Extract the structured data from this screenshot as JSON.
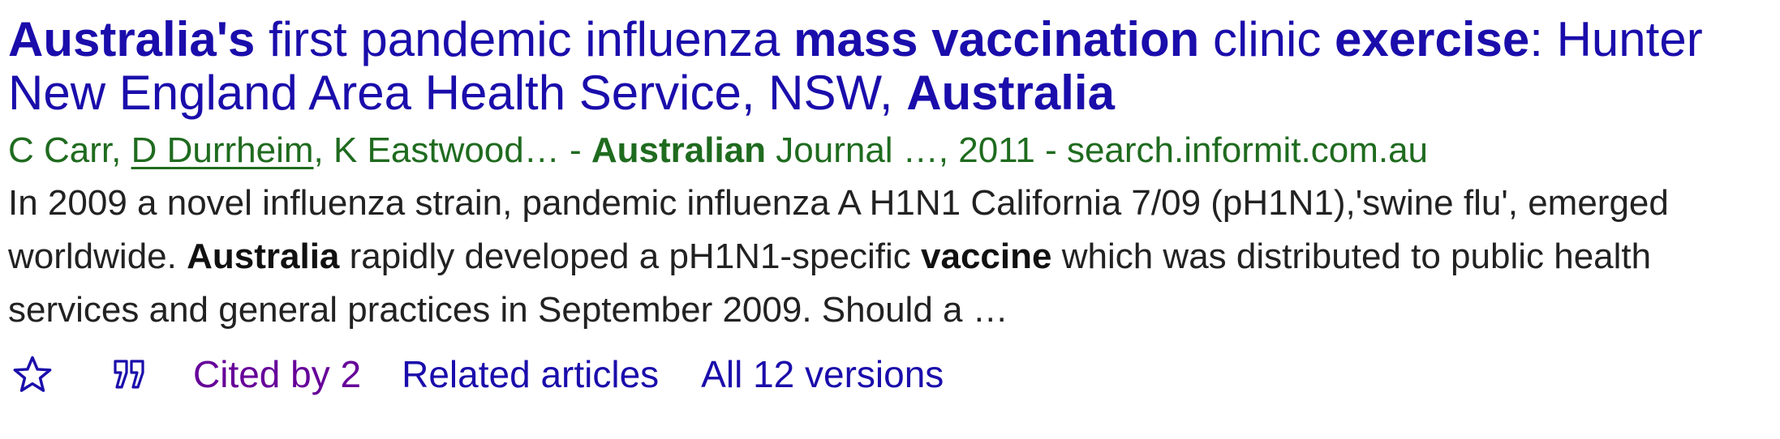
{
  "result": {
    "title": {
      "segments": [
        {
          "text": "Australia's",
          "bold": true
        },
        {
          "text": " first pandemic influenza ",
          "bold": false
        },
        {
          "text": "mass vaccination",
          "bold": true
        },
        {
          "text": " clinic ",
          "bold": false
        },
        {
          "text": "exercise",
          "bold": true
        },
        {
          "text": ": Hunter New England Area Health Service, NSW, ",
          "bold": false
        },
        {
          "text": "Australia",
          "bold": true
        }
      ]
    },
    "meta": {
      "author_1": "C Carr, ",
      "author_2_link": "D Durrheim",
      "author_rest": ", K Eastwood… - ",
      "journal_bold": "Australian",
      "journal_rest": " Journal …, 2011 - search.informit.com.au"
    },
    "snippet": {
      "segments": [
        {
          "text": "In 2009 a novel influenza strain, pandemic influenza A H1N1 California 7/09 (pH1N1),'swine flu', emerged worldwide. ",
          "bold": false
        },
        {
          "text": "Australia",
          "bold": true
        },
        {
          "text": " rapidly developed a pH1N1-specific ",
          "bold": false
        },
        {
          "text": "vaccine",
          "bold": true
        },
        {
          "text": " which was distributed to public health services and general practices in September 2009. Should a …",
          "bold": false
        }
      ]
    },
    "actions": {
      "save_icon": "star-outline-icon",
      "cite_icon": "quote-icon",
      "cited_by": "Cited by 2",
      "related": "Related articles",
      "versions": "All 12 versions"
    },
    "colors": {
      "title_link": "#1a0dab",
      "meta_green": "#1f6b1f",
      "snippet_text": "#222222",
      "cited_by": "#660099",
      "icon_blue": "#1a0dab"
    }
  }
}
